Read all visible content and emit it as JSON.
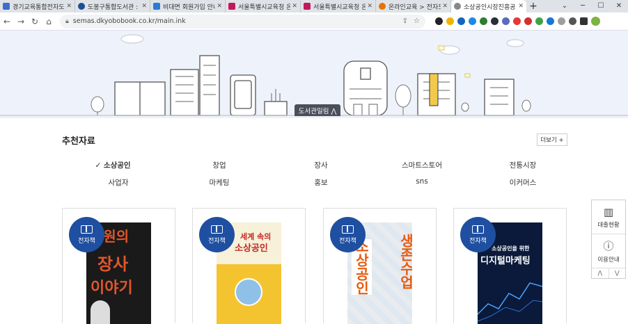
{
  "browser": {
    "tabs": [
      {
        "title": "경기교육통합전자도",
        "favicon_color": "#3d6ec9"
      },
      {
        "title": "도봉구통합도서관 :",
        "favicon_color": "#1d4f91"
      },
      {
        "title": "비대면 회원가입 안내",
        "favicon_color": "#2b7bd6"
      },
      {
        "title": "서울특별시교육청 온",
        "favicon_color": "#c2185b"
      },
      {
        "title": "서울특별시교육청 온",
        "favicon_color": "#c2185b"
      },
      {
        "title": "온라인교육 > 전자도",
        "favicon_color": "#e8710a"
      },
      {
        "title": "소상공인시장진흥공",
        "favicon_color": "#777777"
      }
    ],
    "new_tab": "+",
    "url": "semas.dkyobobook.co.kr/main.ink"
  },
  "hero": {
    "library_button": "도서관일림 ⋀"
  },
  "recommended": {
    "title": "추천자료",
    "more_label": "더보기 +",
    "categories": [
      {
        "label": "✓ 소상공인"
      },
      {
        "label": "창업"
      },
      {
        "label": "장사"
      },
      {
        "label": "스마트스토어"
      },
      {
        "label": "전통시장"
      },
      {
        "label": "사업자"
      },
      {
        "label": "마케팅"
      },
      {
        "label": "홍보"
      },
      {
        "label": "sns"
      },
      {
        "label": "이커머스"
      }
    ],
    "books": [
      {
        "badge": "전자책",
        "cover_lines": [
          "종원의",
          "장사",
          "이야기"
        ]
      },
      {
        "badge": "전자책",
        "cover_lines": [
          "세계 속의",
          "소상공인"
        ]
      },
      {
        "badge": "전자책",
        "cover_lines": [
          "생존수업",
          "소상공인"
        ]
      },
      {
        "badge": "전자책",
        "cover_lines": [
          "소상공인을 위한",
          "디지털마케팅"
        ]
      }
    ]
  },
  "quick_menu": {
    "items": [
      {
        "label": "대출현황",
        "icon": "bar-chart-icon"
      },
      {
        "label": "이용안내",
        "icon": "info-book-icon"
      }
    ],
    "up": "⋀",
    "down": "⋁"
  },
  "colors": {
    "badge": "#1f4fa0",
    "hero_bg": "#eef2fa"
  }
}
